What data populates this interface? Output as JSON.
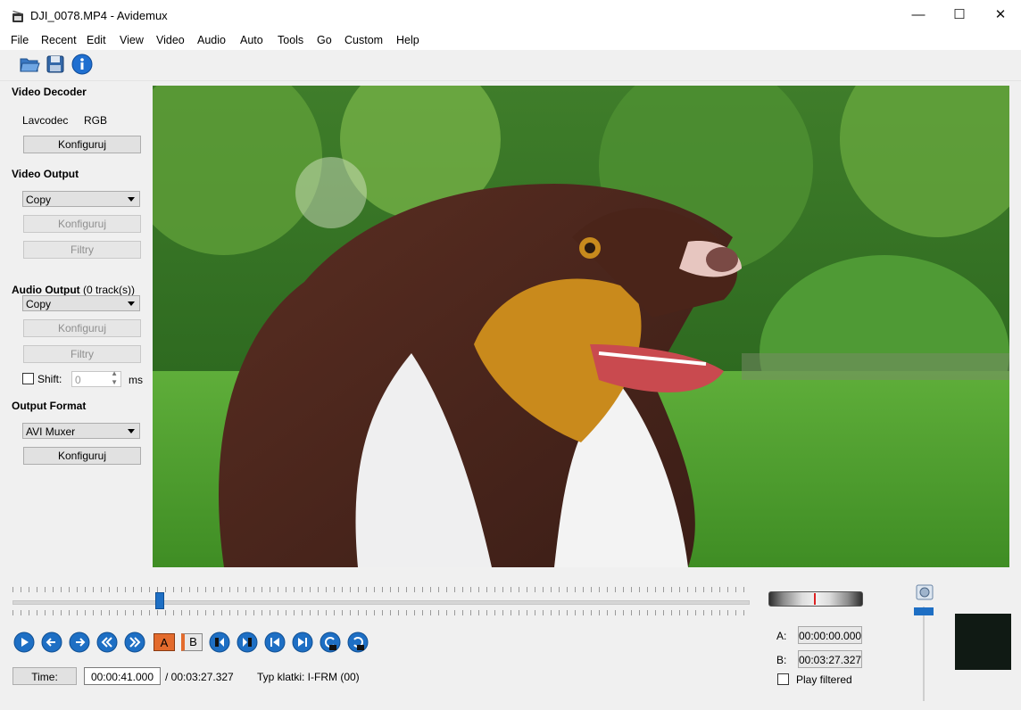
{
  "window": {
    "title": "DJI_0078.MP4 - Avidemux",
    "minimize": "—",
    "maximize": "☐",
    "close": "✕"
  },
  "menu": [
    "File",
    "Recent",
    "Edit",
    "View",
    "Video",
    "Audio",
    "Auto",
    "Tools",
    "Go",
    "Custom",
    "Help"
  ],
  "toolbar": {
    "icons": [
      "open-folder-icon",
      "save-floppy-icon",
      "info-icon"
    ]
  },
  "video_decoder": {
    "title": "Video Decoder",
    "codec": "Lavcodec",
    "colorspace": "RGB",
    "configure_label": "Konfiguruj"
  },
  "video_output": {
    "title": "Video Output",
    "selected": "Copy",
    "configure_label": "Konfiguruj",
    "filters_label": "Filtry"
  },
  "audio_output": {
    "title": "Audio Output",
    "tracks": "(0 track(s))",
    "selected": "Copy",
    "configure_label": "Konfiguruj",
    "filters_label": "Filtry",
    "shift_label": "Shift:",
    "shift_value": "0",
    "shift_unit": "ms"
  },
  "output_format": {
    "title": "Output Format",
    "selected": "AVI Muxer",
    "configure_label": "Konfiguruj"
  },
  "timeline": {
    "position_fraction": 0.2
  },
  "navigation": {
    "buttons": [
      "play-icon",
      "previous-frame-icon",
      "next-frame-icon",
      "previous-keyframe-icon",
      "next-keyframe-icon",
      "set-marker-a-icon",
      "set-marker-b-icon",
      "previous-black-frame-icon",
      "next-black-frame-icon",
      "go-to-first-frame-icon",
      "go-to-last-frame-icon",
      "previous-cut-point-icon",
      "next-cut-point-icon"
    ],
    "marker_a_label": "A",
    "marker_b_label": "B"
  },
  "status": {
    "time_label": "Time:",
    "current_time": "00:00:41.000",
    "total_time": "/ 00:03:27.327",
    "frame_type": "Typ klatki:  I-FRM (00)"
  },
  "selection": {
    "a_label": "A:",
    "a_value": "00:00:00.000",
    "b_label": "B:",
    "b_value": "00:03:27.327",
    "play_filtered_label": "Play filtered"
  },
  "colors": {
    "accent": "#1e6fc4",
    "marker": "#d22222"
  }
}
